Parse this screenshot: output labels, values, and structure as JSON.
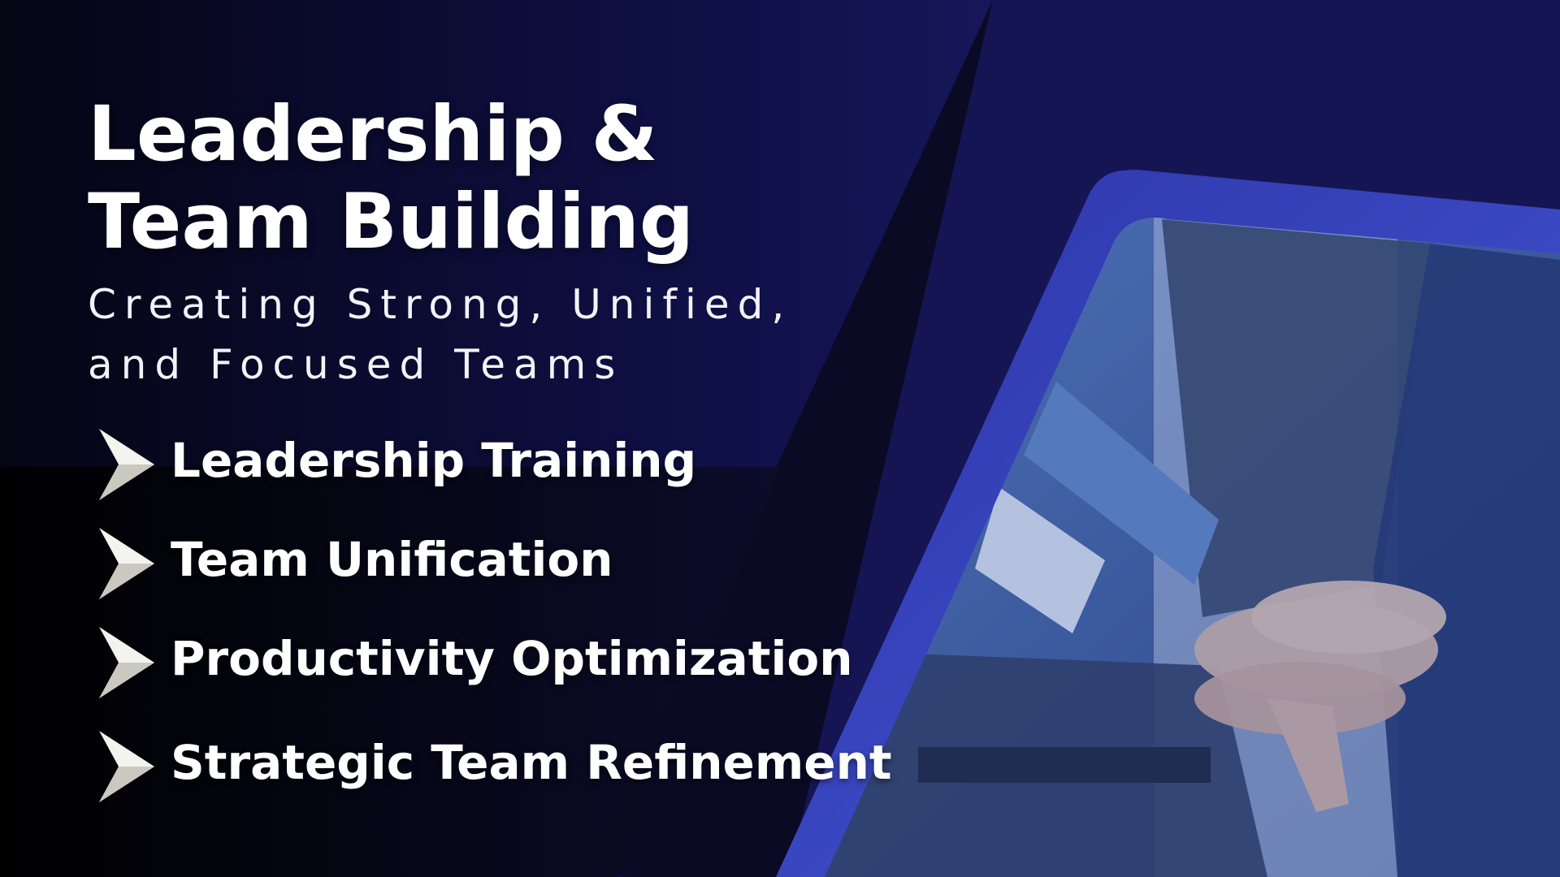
{
  "slide": {
    "title_lines": [
      "Leadership &",
      "Team Building"
    ],
    "subtitle_lines": [
      "Creating Strong, Unified,",
      "and Focused Teams"
    ],
    "items": [
      {
        "label": "Leadership Training",
        "icon": "chevron-arrow-icon"
      },
      {
        "label": "Team Unification",
        "icon": "chevron-arrow-icon"
      },
      {
        "label": "Productivity Optimization",
        "icon": "chevron-arrow-icon"
      },
      {
        "label": "Strategic Team Refinement",
        "icon": "chevron-arrow-icon"
      }
    ],
    "photo": {
      "subject": "team-hands-stacked-photo"
    },
    "colors": {
      "background_dark": "#020206",
      "background_navy": "#1e1e7a",
      "frame_blue": "#3b4bd0",
      "photo_tint": "#4a6fb8",
      "text": "#ffffff"
    }
  }
}
